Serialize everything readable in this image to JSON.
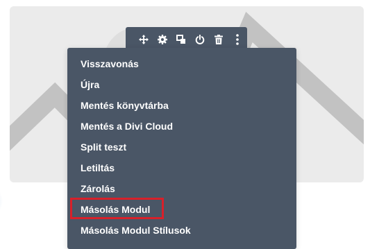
{
  "toolbar": {
    "icons": [
      "move-icon",
      "gear-icon",
      "duplicate-icon",
      "power-icon",
      "trash-icon",
      "more-vertical-icon"
    ]
  },
  "context_menu": {
    "items": [
      {
        "label": "Visszavonás"
      },
      {
        "label": "Újra"
      },
      {
        "label": "Mentés könyvtárba"
      },
      {
        "label": "Mentés a Divi Cloud"
      },
      {
        "label": "Split teszt"
      },
      {
        "label": "Letiltás"
      },
      {
        "label": "Zárolás"
      },
      {
        "label": "Másolás Modul",
        "highlighted": true
      },
      {
        "label": "Másolás Modul Stílusok"
      }
    ]
  },
  "colors": {
    "menu_background": "#4a5666",
    "menu_text": "#ffffff",
    "placeholder_background": "#ebebeb",
    "placeholder_shape": "#c2c2c2",
    "highlight_border": "#d8202a"
  }
}
